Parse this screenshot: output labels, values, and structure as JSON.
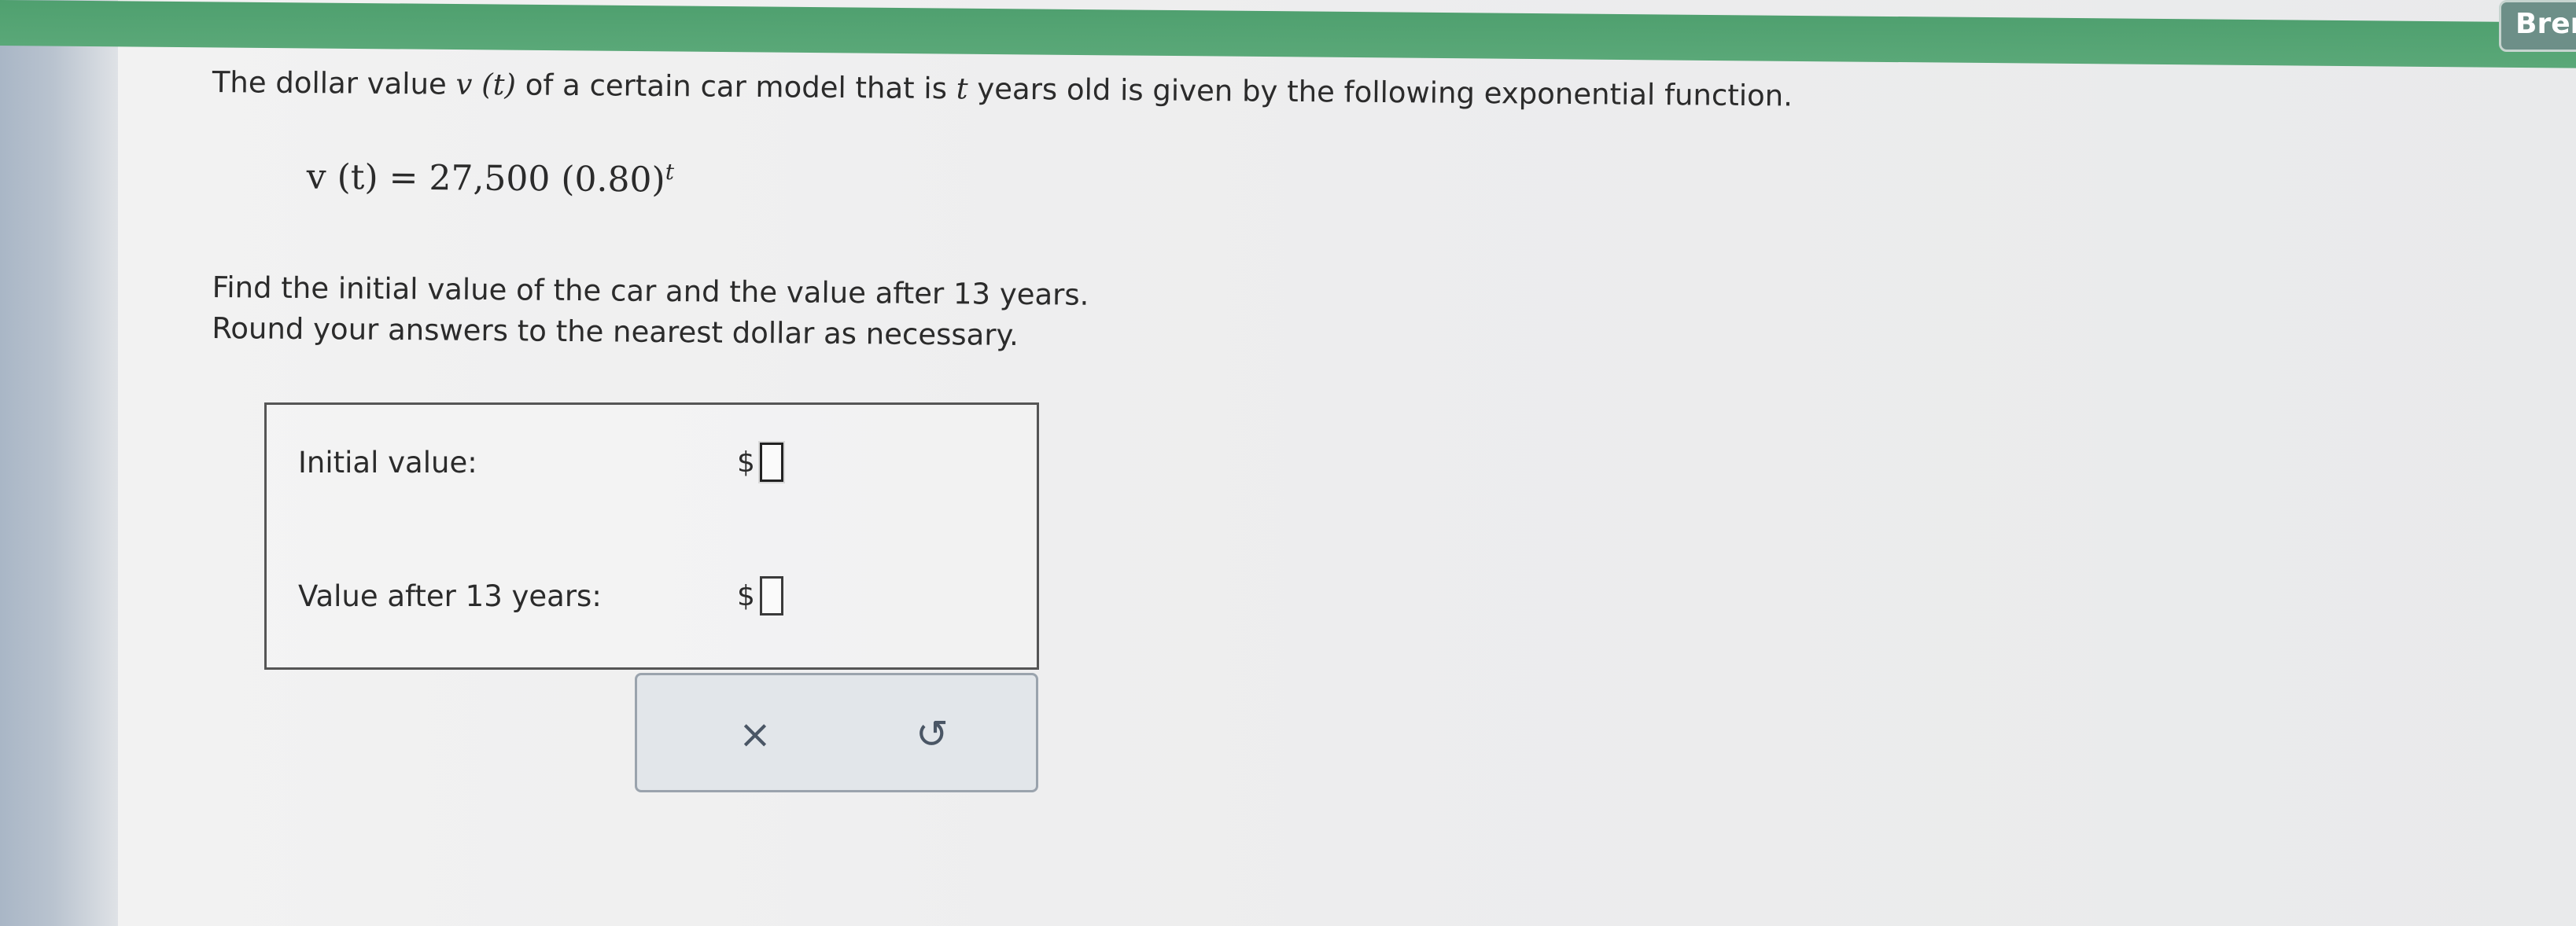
{
  "header": {
    "user_label": "Brer",
    "accent_color": "#4fa06f"
  },
  "question": {
    "line1_pre": "The dollar value ",
    "line1_v": "v",
    "line1_t": "(t)",
    "line1_mid": " of a certain car model that is ",
    "line1_t2": "t",
    "line1_post": " years old is given by the following exponential function."
  },
  "formula": {
    "lhs": "v (t) = 27,500 (0.80)",
    "exponent": "t"
  },
  "instructions": {
    "line1": "Find the initial value of the car and the value after 13 years.",
    "line2": "Round your answers to the nearest dollar as necessary."
  },
  "answers": {
    "initial_label": "Initial value:",
    "initial_prefix": "$",
    "initial_value": "",
    "after_label": "Value after 13 years:",
    "after_prefix": "$",
    "after_value": ""
  },
  "actions": {
    "clear_icon": "×",
    "undo_icon": "↺",
    "clear_icon_name": "close-icon",
    "undo_icon_name": "undo-icon"
  }
}
